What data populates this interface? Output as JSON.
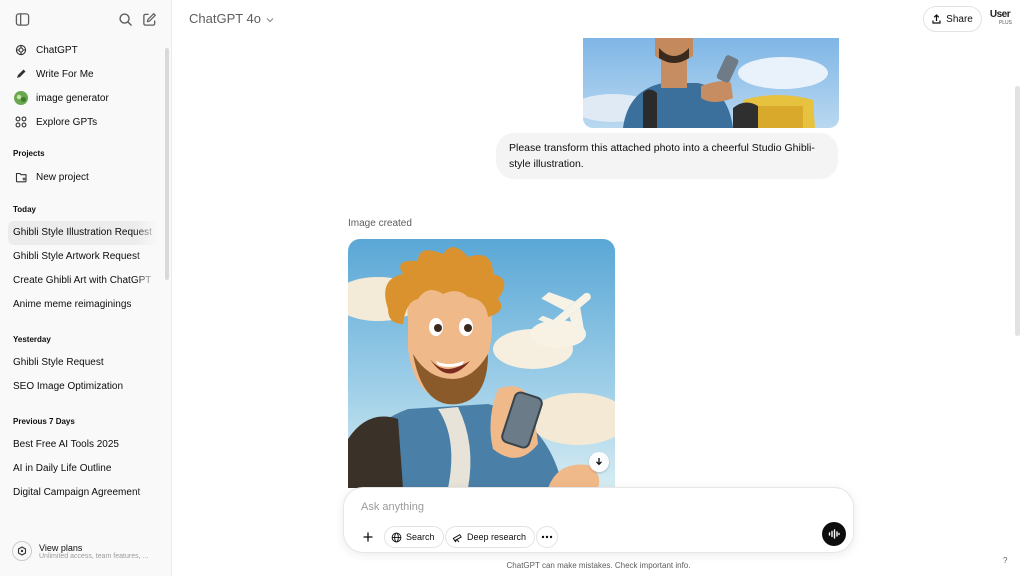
{
  "header": {
    "model": "ChatGPT 4o",
    "share_label": "Share",
    "user_badge": "User",
    "user_badge_sub": "PLUS"
  },
  "sidebar": {
    "nav": [
      {
        "label": "ChatGPT",
        "icon": "openai-logo-icon"
      },
      {
        "label": "Write For Me",
        "icon": "pencil-icon"
      },
      {
        "label": "image generator",
        "icon": "gpt-avatar-icon"
      },
      {
        "label": "Explore GPTs",
        "icon": "grid-icon"
      }
    ],
    "projects_heading": "Projects",
    "new_project": "New project",
    "sections": [
      {
        "heading": "Today",
        "chats": [
          "Ghibli Style Illustration Request",
          "Ghibli Style Artwork Request",
          "Create Ghibli Art with ChatGPT",
          "Anime meme reimaginings"
        ]
      },
      {
        "heading": "Yesterday",
        "chats": [
          "Ghibli Style Request",
          "SEO Image Optimization"
        ]
      },
      {
        "heading": "Previous 7 Days",
        "chats": [
          "Best Free AI Tools 2025",
          "AI in Daily Life Outline",
          "Digital Campaign Agreement"
        ]
      }
    ],
    "view_plans": "View plans",
    "view_plans_sub": "Unlimited access, team features, ..."
  },
  "conversation": {
    "user_message": "Please transform this attached photo into a cheerful Studio Ghibli-style illustration.",
    "image_label": "Image created"
  },
  "composer": {
    "placeholder": "Ask anything",
    "search_label": "Search",
    "deep_research_label": "Deep research"
  },
  "footer": {
    "disclaimer": "ChatGPT can make mistakes. Check important info.",
    "help": "?"
  },
  "colors": {
    "sidebar_bg": "#f9f9f9",
    "active_chat_bg": "#ececec",
    "bubble_bg": "#f4f4f4",
    "voice_btn_bg": "#0d0d0d"
  }
}
